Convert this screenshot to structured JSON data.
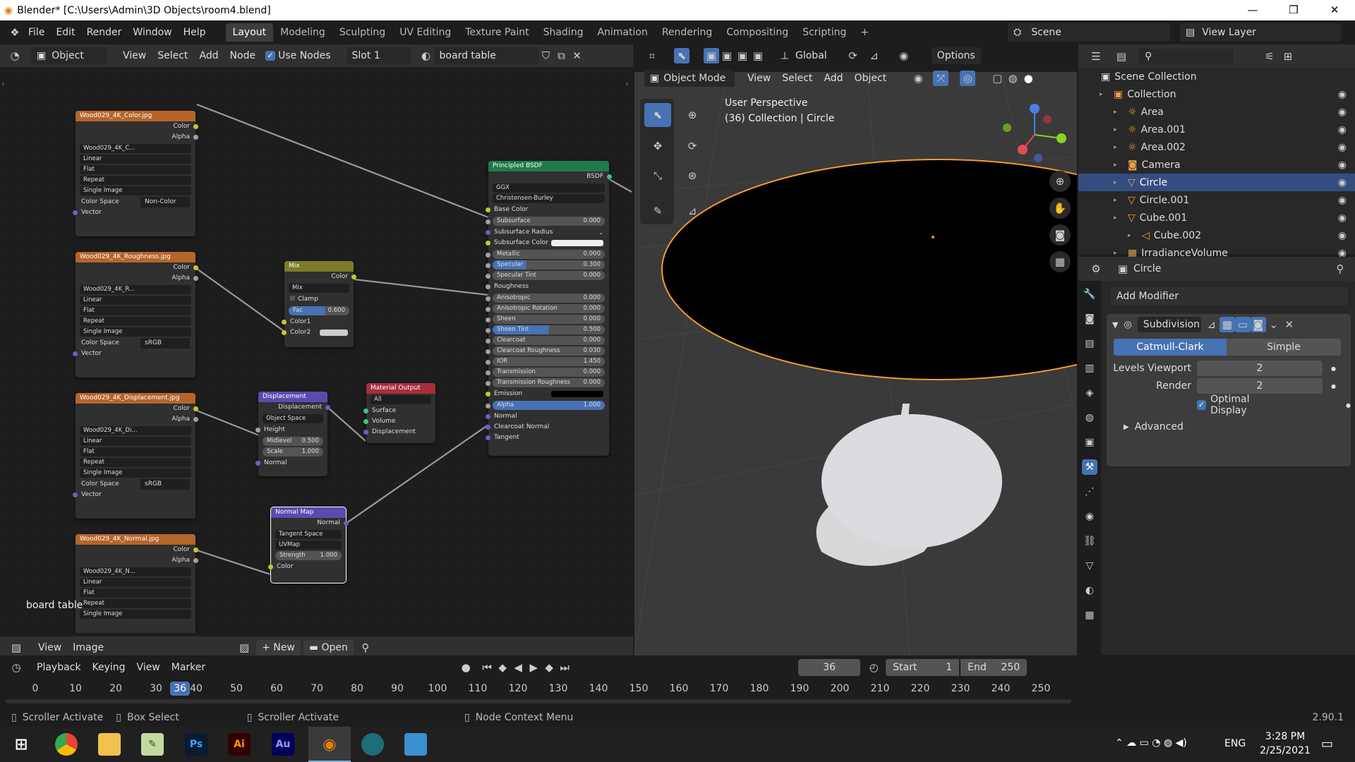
{
  "titlebar": {
    "title": "Blender* [C:\\Users\\Admin\\3D Objects\\room4.blend]",
    "min": "—",
    "max": "❐",
    "close": "✕"
  },
  "menus": [
    "File",
    "Edit",
    "Render",
    "Window",
    "Help"
  ],
  "workspaces": [
    "Layout",
    "Modeling",
    "Sculpting",
    "UV Editing",
    "Texture Paint",
    "Shading",
    "Animation",
    "Rendering",
    "Compositing",
    "Scripting",
    "+"
  ],
  "scene": "Scene",
  "view_layer": "View Layer",
  "node_header": {
    "mode": "Object",
    "view": "View",
    "select": "Select",
    "add": "Add",
    "node": "Node",
    "use_nodes": "Use Nodes",
    "slot": "Slot 1",
    "material": "board table"
  },
  "viewport_header": {
    "mode": "Object Mode",
    "view": "View",
    "select": "Select",
    "add": "Add",
    "object": "Object",
    "orientation": "Global",
    "options": "Options"
  },
  "viewport_info": {
    "perspective": "User Perspective",
    "collection": "(36) Collection | Circle"
  },
  "nodes": {
    "img1": {
      "title": "Wood029_4K_Color.jpg",
      "out1": "Color",
      "out2": "Alpha",
      "file": "Wood029_4K_C...",
      "interp": "Linear",
      "proj": "Flat",
      "ext": "Repeat",
      "src": "Single Image",
      "cs_label": "Color Space",
      "cs": "Non-Color",
      "vec": "Vector"
    },
    "img2": {
      "title": "Wood029_4K_Roughness.jpg",
      "out1": "Color",
      "out2": "Alpha",
      "file": "Wood029_4K_R...",
      "interp": "Linear",
      "proj": "Flat",
      "ext": "Repeat",
      "src": "Single Image",
      "cs_label": "Color Space",
      "cs": "sRGB",
      "vec": "Vector"
    },
    "img3": {
      "title": "Wood029_4K_Displacement.jpg",
      "out1": "Color",
      "out2": "Alpha",
      "file": "Wood029_4K_Di...",
      "interp": "Linear",
      "proj": "Flat",
      "ext": "Repeat",
      "src": "Single Image",
      "cs_label": "Color Space",
      "cs": "sRGB",
      "vec": "Vector"
    },
    "img4": {
      "title": "Wood029_4K_Normal.jpg",
      "out1": "Color",
      "out2": "Alpha",
      "file": "Wood029_4K_N...",
      "interp": "Linear",
      "proj": "Flat",
      "ext": "Repeat",
      "src": "Single Image"
    },
    "mix": {
      "title": "Mix",
      "out": "Color",
      "blend": "Mix",
      "clamp": "Clamp",
      "fac_label": "Fac",
      "fac": "0.600",
      "c1": "Color1",
      "c2": "Color2"
    },
    "disp": {
      "title": "Displacement",
      "out": "Displacement",
      "space": "Object Space",
      "height": "Height",
      "mid_label": "Midlevel",
      "mid": "0.500",
      "scale_label": "Scale",
      "scale": "1.000",
      "normal": "Normal"
    },
    "matout": {
      "title": "Material Output",
      "target": "All",
      "surface": "Surface",
      "volume": "Volume",
      "disp": "Displacement"
    },
    "normal": {
      "title": "Normal Map",
      "out": "Normal",
      "space": "Tangent Space",
      "uv": "UVMap",
      "str_label": "Strength",
      "str": "1.000",
      "color": "Color"
    },
    "bsdf": {
      "title": "Principled BSDF",
      "out": "BSDF",
      "dist": "GGX",
      "ss": "Christensen-Burley",
      "rows": [
        {
          "k": "Base Color",
          "v": "",
          "t": "sock"
        },
        {
          "k": "Subsurface",
          "v": "0.000",
          "t": "sl"
        },
        {
          "k": "Subsurface Radius",
          "v": "",
          "t": "dd"
        },
        {
          "k": "Subsurface Color",
          "v": "",
          "t": "col"
        },
        {
          "k": "Metallic",
          "v": "0.000",
          "t": "sl"
        },
        {
          "k": "Specular",
          "v": "0.300",
          "t": "slb",
          "p": "30%"
        },
        {
          "k": "Specular Tint",
          "v": "0.000",
          "t": "sl"
        },
        {
          "k": "Roughness",
          "v": "",
          "t": "sock"
        },
        {
          "k": "Anisotropic",
          "v": "0.000",
          "t": "sl"
        },
        {
          "k": "Anisotropic Rotation",
          "v": "0.000",
          "t": "sl"
        },
        {
          "k": "Sheen",
          "v": "0.000",
          "t": "sl"
        },
        {
          "k": "Sheen Tint",
          "v": "0.500",
          "t": "slb",
          "p": "50%"
        },
        {
          "k": "Clearcoat",
          "v": "0.000",
          "t": "sl"
        },
        {
          "k": "Clearcoat Roughness",
          "v": "0.030",
          "t": "sl"
        },
        {
          "k": "IOR",
          "v": "1.450",
          "t": "sl"
        },
        {
          "k": "Transmission",
          "v": "0.000",
          "t": "sl"
        },
        {
          "k": "Transmission Roughness",
          "v": "0.000",
          "t": "sl"
        },
        {
          "k": "Emission",
          "v": "",
          "t": "colb"
        },
        {
          "k": "Alpha",
          "v": "1.000",
          "t": "slb",
          "p": "100%"
        },
        {
          "k": "Normal",
          "v": "",
          "t": "sock"
        },
        {
          "k": "Clearcoat Normal",
          "v": "",
          "t": "sock"
        },
        {
          "k": "Tangent",
          "v": "",
          "t": "sock"
        }
      ]
    }
  },
  "editor_label": "board table",
  "image_header": {
    "view": "View",
    "image": "Image",
    "new": "New",
    "open": "Open"
  },
  "outliner": {
    "root": "Scene Collection",
    "items": [
      {
        "name": "Collection",
        "indent": 1
      },
      {
        "name": "Area",
        "indent": 2
      },
      {
        "name": "Area.001",
        "indent": 2
      },
      {
        "name": "Area.002",
        "indent": 2
      },
      {
        "name": "Camera",
        "indent": 2
      },
      {
        "name": "Circle",
        "indent": 2,
        "selected": true
      },
      {
        "name": "Circle.001",
        "indent": 2
      },
      {
        "name": "Cube.001",
        "indent": 2
      },
      {
        "name": "Cube.002",
        "indent": 3
      },
      {
        "name": "IrradianceVolume",
        "indent": 2
      }
    ]
  },
  "props": {
    "object": "Circle",
    "add_modifier": "Add Modifier",
    "modifier": "Subdivision",
    "catmull": "Catmull-Clark",
    "simple": "Simple",
    "levels_label": "Levels Viewport",
    "levels": "2",
    "render_label": "Render",
    "render": "2",
    "optimal": "Optimal Display",
    "advanced": "Advanced"
  },
  "timeline": {
    "playback": "Playback",
    "keying": "Keying",
    "view": "View",
    "marker": "Marker",
    "frame": "36",
    "start_label": "Start",
    "start": "1",
    "end_label": "End",
    "end": "250",
    "ticks": [
      "0",
      "10",
      "20",
      "30",
      "40",
      "50",
      "60",
      "70",
      "80",
      "90",
      "100",
      "110",
      "120",
      "130",
      "140",
      "150",
      "160",
      "170",
      "180",
      "190",
      "200",
      "210",
      "220",
      "230",
      "240",
      "250"
    ],
    "current": "36"
  },
  "status": {
    "s1": "Scroller Activate",
    "s2": "Box Select",
    "s3": "Scroller Activate",
    "s4": "Node Context Menu",
    "version": "2.90.1"
  },
  "taskbar": {
    "time": "3:28 PM",
    "date": "2/25/2021",
    "lang": "ENG"
  }
}
